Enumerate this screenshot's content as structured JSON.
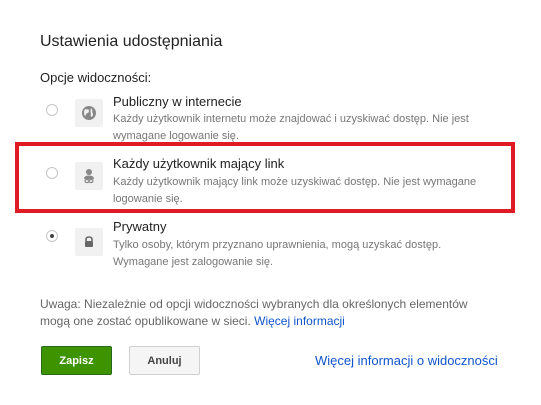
{
  "dialog": {
    "title": "Ustawienia udostępniania",
    "visibility_label": "Opcje widoczności:"
  },
  "options": [
    {
      "title": "Publiczny w internecie",
      "desc_line1": "Każdy użytkownik internetu może znajdować i uzyskiwać dostęp. Nie jest",
      "desc_line2": "wymagane logowanie się.",
      "icon": "globe-icon",
      "selected": false
    },
    {
      "title": "Każdy użytkownik mający link",
      "desc_line1": "Każdy użytkownik mający link może uzyskiwać dostęp. Nie jest wymagane",
      "desc_line2": "logowanie się.",
      "icon": "link-person-icon",
      "selected": false
    },
    {
      "title": "Prywatny",
      "desc_line1": "Tylko osoby, którym przyznano uprawnienia, mogą uzyskać dostęp.",
      "desc_line2": "Wymagane jest zalogowanie się.",
      "icon": "lock-icon",
      "selected": true
    }
  ],
  "note": {
    "line1": "Uwaga: Niezależnie od opcji widoczności wybranych dla określonych elementów",
    "line2": "mogą one zostać opublikowane w sieci.",
    "link": "Więcej informacji"
  },
  "buttons": {
    "save": "Zapisz",
    "cancel": "Anuluj"
  },
  "footer_link": "Więcej informacji o widoczności",
  "colors": {
    "highlight": "#e01b24",
    "save_button": "#3d9400",
    "link": "#1155cc"
  }
}
